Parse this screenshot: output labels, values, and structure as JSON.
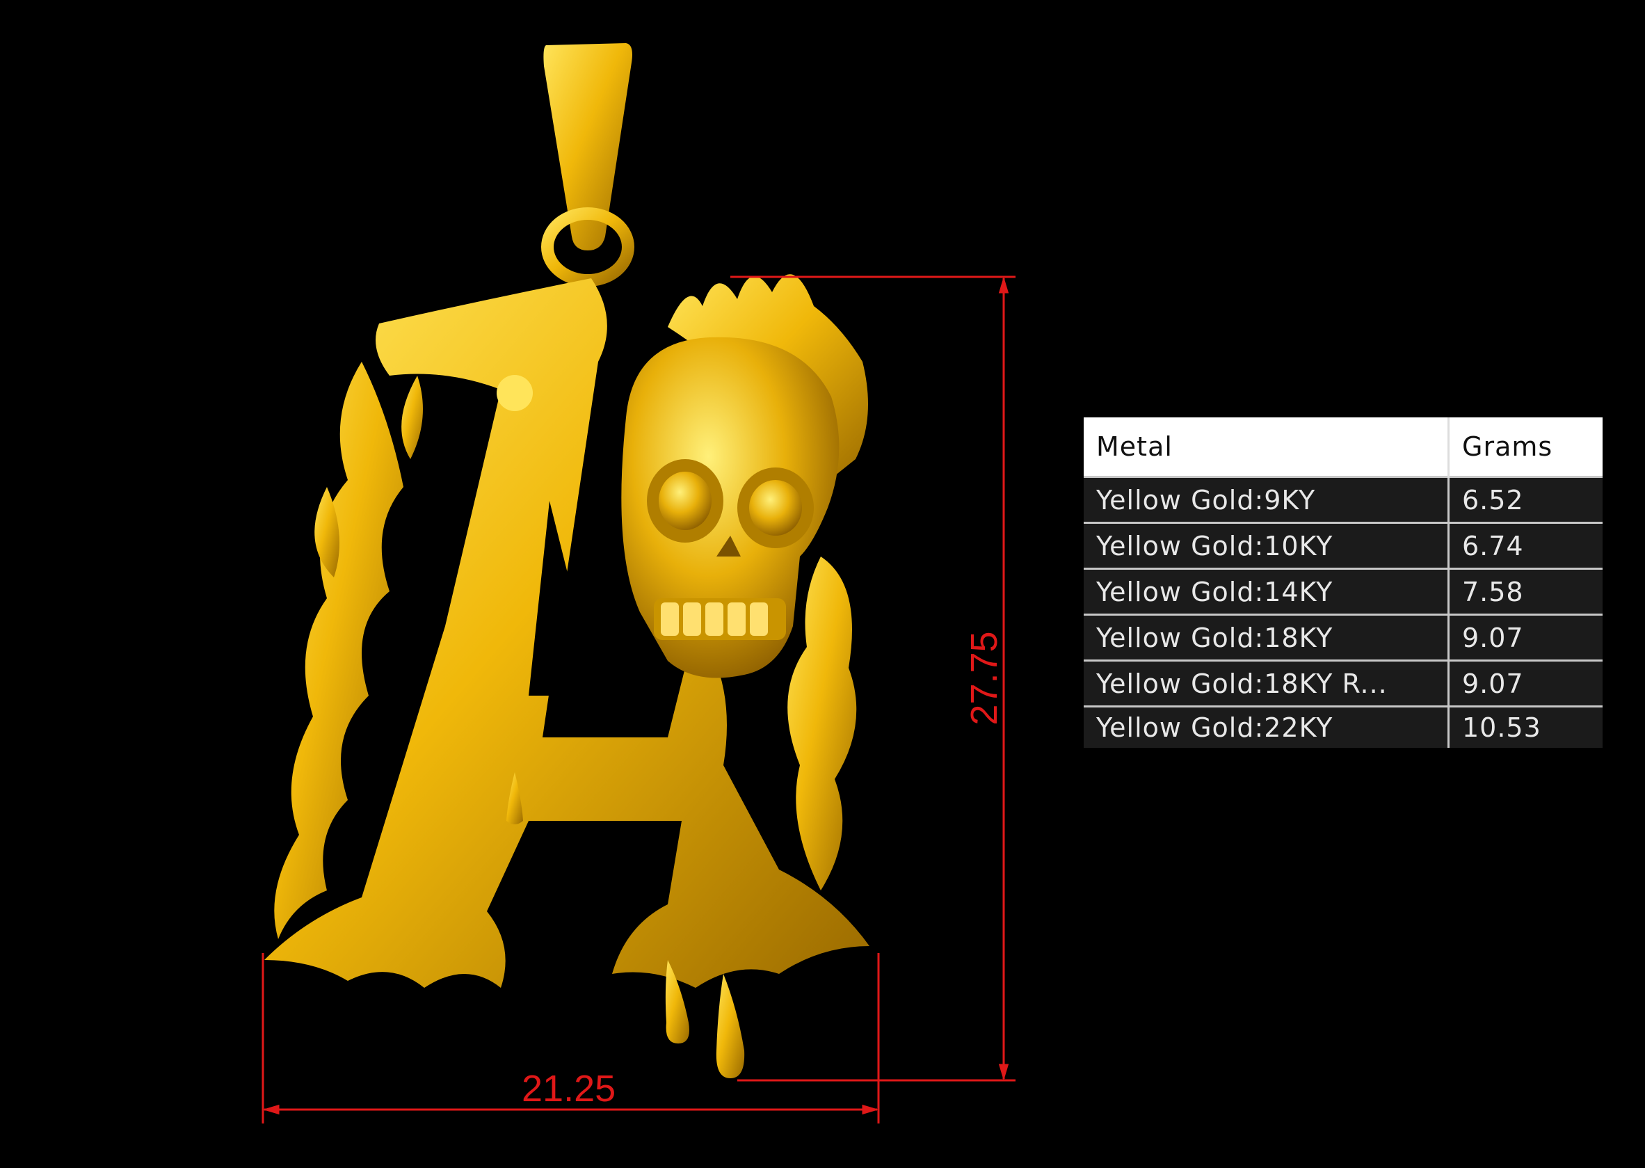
{
  "dimensions": {
    "width": "21.25",
    "height": "27.75"
  },
  "colors": {
    "gold": "#f2c00f",
    "dimension_line": "#e01818",
    "background": "#000000"
  },
  "weight_table": {
    "headers": {
      "metal": "Metal",
      "grams": "Grams"
    },
    "rows": [
      {
        "metal": "Yellow Gold:9KY",
        "grams": "6.52"
      },
      {
        "metal": "Yellow Gold:10KY",
        "grams": "6.74"
      },
      {
        "metal": "Yellow Gold:14KY",
        "grams": "7.58"
      },
      {
        "metal": "Yellow Gold:18KY",
        "grams": "9.07"
      },
      {
        "metal": "Yellow Gold:18KY R...",
        "grams": "9.07"
      },
      {
        "metal": "Yellow Gold:22KY",
        "grams": "10.53"
      }
    ]
  }
}
